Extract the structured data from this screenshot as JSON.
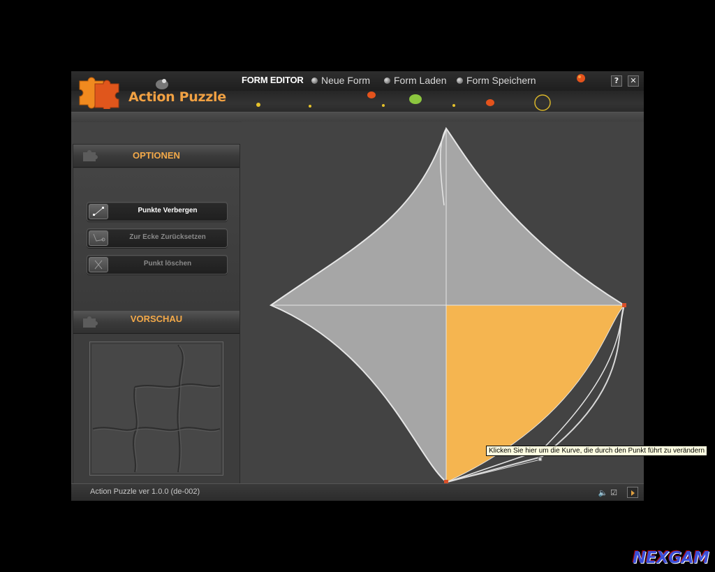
{
  "app": {
    "logo_text": "Action Puzzle",
    "version_text": "Action Puzzle ver 1.0.0 (de-002)"
  },
  "nav": {
    "active": "FORM EDITOR",
    "items": [
      "Neue Form",
      "Form Laden",
      "Form Speichern"
    ]
  },
  "window_buttons": {
    "help": "?",
    "close": "✕"
  },
  "optionen": {
    "title": "OPTIONEN",
    "buttons": [
      {
        "label": "Punkte Verbergen",
        "enabled": true,
        "icon": "points-icon"
      },
      {
        "label": "Zur Ecke Zurücksetzen",
        "enabled": false,
        "icon": "reset-corner-icon"
      },
      {
        "label": "Punkt löschen",
        "enabled": false,
        "icon": "delete-point-icon"
      }
    ]
  },
  "vorschau": {
    "title": "VORSCHAU"
  },
  "editor": {
    "tooltip": "Klicken Sie hier um die Kurve, die durch den Punkt führt zu verändern",
    "fill_color": "#a6a6a6",
    "highlight_color": "#f5b550"
  },
  "watermark": "NEXGAM",
  "colors": {
    "accent": "#f3a949",
    "background": "#434343"
  }
}
